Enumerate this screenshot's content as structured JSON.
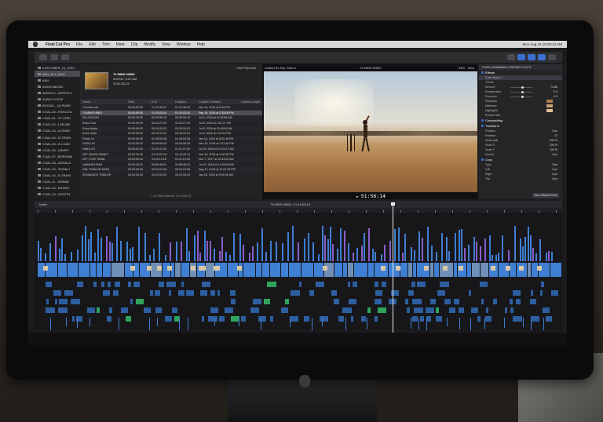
{
  "menubar": {
    "items": [
      "Final Cut Pro",
      "File",
      "Edit",
      "Trim",
      "Mark",
      "Clip",
      "Modify",
      "View",
      "Window",
      "Help"
    ],
    "status": "Mon Aug 15  10:28:12 AM"
  },
  "sidebar": {
    "items": [
      "CUSTOMER_HI_CRIC...",
      "AIAJ_ALL_MAS",
      "ANU",
      "AUDIO-MUSIC",
      "AUDIO-S...DEFFECT",
      "AUDIO-VOICE",
      "BOGAS-...10-PUNE",
      "COAL-00...HOKLICA",
      "COAL-01...ST-CRIC",
      "COAL-02...LZB-000",
      "COAL-03...A-SHAR",
      "COAL-04...N-TRAIN",
      "COAL-05...E-LOAD",
      "COAL-06...ASHRY",
      "COAL-07...BOROWA",
      "COAL-08...ADHALA",
      "COAL-09...SONALI",
      "COAL-10...N-TRAIN",
      "COAL-11...DHANA",
      "COAL-12...NIHARY",
      "COAL-13...CENTRL",
      "COAL-14...BOKLAY",
      "COAL-15...TAKINA",
      "COAL-16...A-MAN",
      "COAL-17...FRETRP",
      "COAL-18...CENTRL"
    ],
    "selected_index": 1
  },
  "browser": {
    "hide_rejected": "Hide Rejected",
    "event_name": "74 MINS HINDI",
    "event_date": "5/29/16, 6:00 AM",
    "event_meta": "2016-08-23",
    "columns": [
      "Name",
      "Start",
      "End",
      "Duration",
      "Content Created",
      "Camera Angle"
    ],
    "rows": [
      [
        "74 mins cuts",
        "00:00:00:00",
        "01:12:38:22",
        "01:12:38:22",
        "Nov 15, 2016 at 5:43 PM",
        ""
      ],
      [
        "74 MINS HINDI",
        "00:00:00:00",
        "01:15:03:10",
        "01:15:03:10",
        "Sep 14, 2016 at 3:35:08 PM",
        ""
      ],
      [
        "EDUCATION",
        "00:00:00:00",
        "00:09:50:15",
        "00:09:50:15",
        "Jul 6, 2016 at 11:39:56 AM",
        ""
      ],
      [
        "Extra-Cost",
        "00:00:00:00",
        "00:20:27:25",
        "00:20:27:25",
        "Jul 8, 2016 at 3:51:21 PM",
        ""
      ],
      [
        "Extra-Hydro",
        "00:00:00:00",
        "00:10:53:23",
        "00:10:53:23",
        "Jul 8, 2016 at 10:45:52 AM",
        ""
      ],
      [
        "Extra-Solar",
        "00:00:00:00",
        "00:15:47:00",
        "00:15:47:00",
        "Jul 8, 2016 at 4:11:04 PM",
        ""
      ],
      [
        "FINAL-HI",
        "00:00:00:00",
        "01:18:52:28",
        "01:18:52:28",
        "Jan 16, 2016 at 8:52:46 PM",
        ""
      ],
      [
        "HAZIA-16",
        "00:00:00:00",
        "00:09:06:28",
        "00:09:06:28",
        "Nov 10, 2016 at 2:57:49 PM",
        ""
      ],
      [
        "HINDI-VO",
        "00:00:00:00",
        "01:11:37:00",
        "01:11:37:00",
        "Jul 29, 2016 at 10:33:17 AM",
        ""
      ],
      [
        "NFT-JASON NANEY",
        "00:00:00:00",
        "01:10:29:15",
        "01:10:29:15",
        "Nov 15, 2016 at 5:30:48 PM",
        ""
      ],
      [
        "NFT-TONY SEBA",
        "00:00:00:00",
        "01:11:14:18",
        "01:11:14:18",
        "Nov 7, 2017 at 10:43:02 AM",
        ""
      ],
      [
        "NAIMUR-HINDI",
        "00:00:00:00",
        "00:58:48:00",
        "00:58:48:00",
        "Jul 19, 2016 at 10:35:08 AM",
        ""
      ],
      [
        "ONL TRAILER-HINDI",
        "00:00:00:00",
        "00:04:21:08",
        "00:04:21:08",
        "Aug 17, 2016 at 12:51:09 PM",
        ""
      ],
      [
        "SUNDANCE TRAILER",
        "00:00:00:00",
        "00:01:53:20",
        "00:01:53:20",
        "Jan 28, 2016 at 9:35:05 AM",
        ""
      ]
    ],
    "selected_row": 1,
    "footer": "1 of 7569 selected, 01:14:59:23"
  },
  "viewer": {
    "left_label": "1080p HD 25p, Stereo",
    "title": "74 MINS HINDI",
    "zoom": "54%",
    "view_menu": "View",
    "timecode": "51:56:14"
  },
  "inspector": {
    "clip_name": "COAL-DHANBAD-CRICKET-CUT4",
    "effects_label": "Effects",
    "color_board": "Color Board 1",
    "tint_label": "TiTone",
    "amount_label": "Amount",
    "amount_value": "74.88",
    "desat_label": "Desaturation",
    "desat_value": "0.3",
    "exposure_label": "Exposure",
    "exposure_value": "1.0",
    "shadows_label": "Shadows",
    "midtones_label": "Midtones",
    "highlights_label": "Highlights",
    "protect_label": "Protect Skin",
    "compositing_label": "Compositing",
    "transform_label": "Transform",
    "position_label": "Position",
    "position_value": "0 px",
    "rotation_label": "Rotation",
    "rotation_value": "0°",
    "scalex_label": "Scale (All)",
    "scalex_value": "100 %",
    "scaley_label": "Scale X",
    "scaley_value": "100 %",
    "scalez_label": "Scale Y",
    "scalez_value": "100 %",
    "anchor_label": "Anchor",
    "anchor_value": "0 px",
    "crop_label": "Crop",
    "type_label": "Type",
    "type_value": "Trim",
    "left_label": "Left",
    "left_value": "0 px",
    "right_label": "Right",
    "right_value": "0 px",
    "top_label": "Top",
    "top_value": "0 px",
    "save_button": "Save Effects Preset",
    "accent": "#3a6fd0"
  },
  "timeline": {
    "index_label": "Index",
    "title": "74 MINS HINDI",
    "duration": "01:15:03:10",
    "clip_colors": {
      "primary": "#3f7fd4",
      "audio": "#2d5ea0",
      "title": "#8a5fc8",
      "music": "#2fa35a"
    }
  }
}
